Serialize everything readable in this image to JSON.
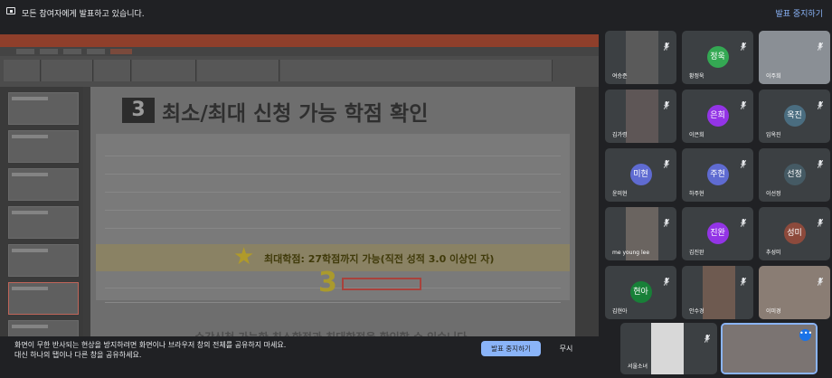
{
  "topbar": {
    "message": "모든 참여자에게 발표하고 있습니다.",
    "stop_label": "발표 중지하기"
  },
  "slide": {
    "number": "3",
    "title": "최소/최대 신청 가능 학점 확인",
    "highlight_text": "최대학점: 27학점까지 가능(직전 성적 3.0 이상인 자)",
    "callout_number": "3",
    "caption": "수강신청 가능한 최소학점과 최대학점을 확인할 수 있습니다."
  },
  "warning": {
    "line1": "화면이 무한 반사되는 현상을 방지하려면 화면이나 브라우저 창의 전체를 공유하지 마세요.",
    "line2": "대신 하나의 탭이나 다른 창을 공유하세요.",
    "stop_button": "발표 중지하기",
    "ignore_button": "무시"
  },
  "participants": [
    {
      "name": "여승준",
      "type": "video",
      "bg": "#5a5a5a"
    },
    {
      "name": "황정욱",
      "initials": "정욱",
      "color": "#34a853"
    },
    {
      "name": "이주희",
      "type": "video",
      "bg": "#8a8f95"
    },
    {
      "name": "김가령",
      "type": "video",
      "bg": "#5e5656"
    },
    {
      "name": "이은희",
      "initials": "은희",
      "color": "#9334e6"
    },
    {
      "name": "임옥진",
      "initials": "옥진",
      "color": "#4a6d80"
    },
    {
      "name": "윤미현",
      "initials": "미현",
      "color": "#5f6bd1"
    },
    {
      "name": "하주현",
      "initials": "주현",
      "color": "#5f6bd1"
    },
    {
      "name": "이선정",
      "initials": "선정",
      "color": "#455a64"
    },
    {
      "name": "me young lee",
      "type": "video",
      "bg": "#6a6460"
    },
    {
      "name": "김진완",
      "initials": "진완",
      "color": "#9334e6"
    },
    {
      "name": "추성미",
      "initials": "성미",
      "color": "#8d4a3c"
    },
    {
      "name": "김현아",
      "initials": "현아",
      "color": "#188038"
    },
    {
      "name": "안수경",
      "type": "video",
      "bg": "#6e5a50"
    },
    {
      "name": "이미경",
      "type": "video",
      "bg": "#8a7d74"
    },
    {
      "name": "서울소녀",
      "type": "video",
      "bg": "#d8d8d8"
    },
    {
      "name": "",
      "type": "video",
      "bg": "#7b7472"
    }
  ]
}
